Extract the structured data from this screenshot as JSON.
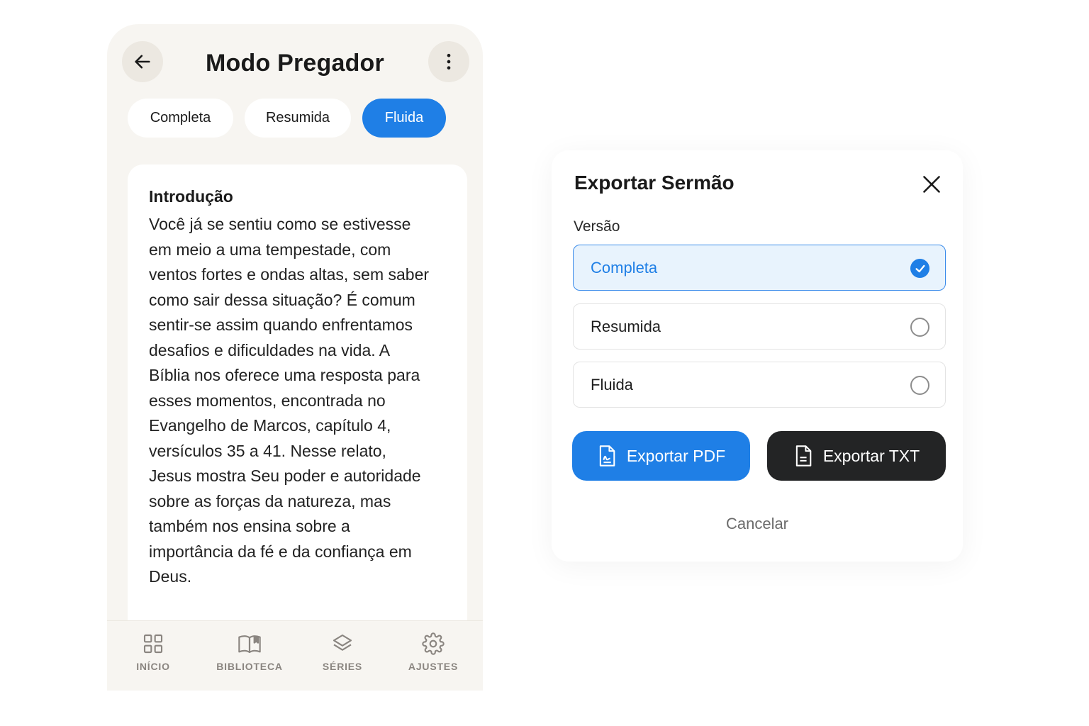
{
  "preacher_screen": {
    "title": "Modo Pregador",
    "back_icon": "arrow-left-icon",
    "more_icon": "more-vertical-icon",
    "tabs": [
      {
        "label": "Completa",
        "active": false
      },
      {
        "label": "Resumida",
        "active": false
      },
      {
        "label": "Fluida",
        "active": true
      }
    ],
    "section": {
      "heading": "Introdução",
      "body": "Você já se sentiu como se estivesse em meio a uma tempestade, com ventos fortes e ondas altas, sem saber como sair dessa situação? É comum sentir-se assim quando enfrentamos desafios e dificuldades na vida. A Bíblia nos oferece uma resposta para esses momentos, encontrada no Evangelho de Marcos, capítulo 4, versículos 35 a 41. Nesse relato, Jesus mostra Seu poder e autoridade sobre as forças da natureza, mas também nos ensina sobre a importância da fé e da confiança em Deus."
    },
    "bottom_nav": [
      {
        "label": "INÍCIO",
        "icon": "grid-icon"
      },
      {
        "label": "BIBLIOTECA",
        "icon": "book-open-icon"
      },
      {
        "label": "SÉRIES",
        "icon": "layers-icon"
      },
      {
        "label": "AJUSTES",
        "icon": "gear-icon"
      }
    ]
  },
  "export_dialog": {
    "title": "Exportar Sermão",
    "close_icon": "close-icon",
    "version_label": "Versão",
    "options": [
      {
        "label": "Completa",
        "selected": true
      },
      {
        "label": "Resumida",
        "selected": false
      },
      {
        "label": "Fluida",
        "selected": false
      }
    ],
    "export_pdf_label": "Exportar PDF",
    "export_txt_label": "Exportar TXT",
    "cancel_label": "Cancelar"
  },
  "colors": {
    "accent": "#1f7fe6",
    "dark_button": "#232425",
    "screen_bg": "#f7f5f1",
    "selected_option_bg": "#e8f3fd"
  }
}
